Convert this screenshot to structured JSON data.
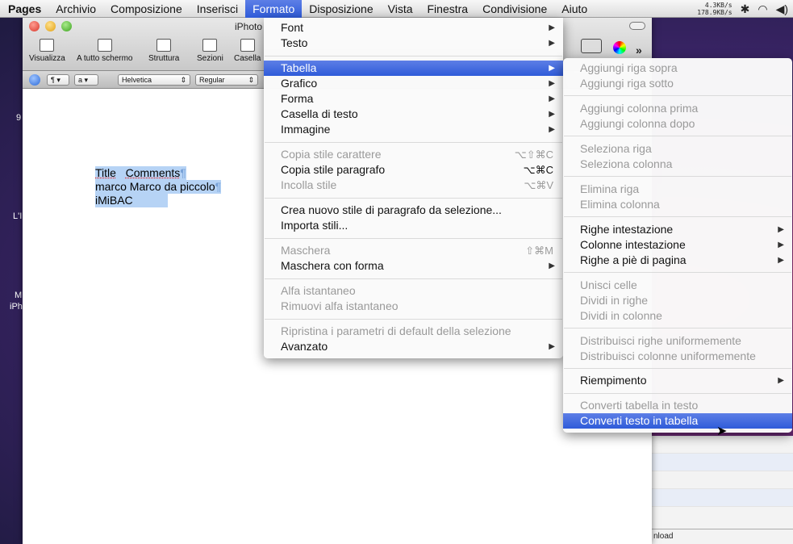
{
  "menubar": {
    "app": "Pages",
    "items": [
      "Archivio",
      "Composizione",
      "Inserisci",
      "Formato",
      "Disposizione",
      "Vista",
      "Finestra",
      "Condivisione",
      "Aiuto"
    ],
    "active": "Formato",
    "netspeed_up": "4.3KB/s",
    "netspeed_down": "178.9KB/s"
  },
  "desktop": {
    "left_labels": [
      "9",
      "L'I",
      "M",
      "iPh"
    ]
  },
  "window": {
    "title": "iPhoto",
    "toolbar": {
      "visualizza": "Visualizza",
      "schermo": "A tutto schermo",
      "struttura": "Struttura",
      "sezioni": "Sezioni",
      "casella": "Casella"
    },
    "formatbar": {
      "paragraph": "¶",
      "char": "a",
      "font": "Helvetica",
      "style": "Regular"
    },
    "document": {
      "line1_a": "Title",
      "line1_b": "Comments",
      "line2": "marco Marco da piccolo",
      "line3": "iMiBAC",
      "pilcrow": "¶"
    }
  },
  "background_window": {
    "download_label": "nload"
  },
  "formato_menu": {
    "items": [
      {
        "label": "Font",
        "submenu": true
      },
      {
        "label": "Testo",
        "submenu": true
      },
      {
        "label": "Tabella",
        "submenu": true,
        "highlighted": true
      },
      {
        "label": "Grafico",
        "submenu": true
      },
      {
        "label": "Forma",
        "submenu": true
      },
      {
        "label": "Casella di testo",
        "submenu": true
      },
      {
        "label": "Immagine",
        "submenu": true
      },
      {
        "label": "Copia stile carattere",
        "shortcut": "⌥⇧⌘C",
        "disabled": true
      },
      {
        "label": "Copia stile paragrafo",
        "shortcut": "⌥⌘C"
      },
      {
        "label": "Incolla stile",
        "shortcut": "⌥⌘V",
        "disabled": true
      },
      {
        "label": "Crea nuovo stile di paragrafo da selezione..."
      },
      {
        "label": "Importa stili..."
      },
      {
        "label": "Maschera",
        "shortcut": "⇧⌘M",
        "disabled": true
      },
      {
        "label": "Maschera con forma",
        "submenu": true
      },
      {
        "label": "Alfa istantaneo",
        "disabled": true
      },
      {
        "label": "Rimuovi alfa istantaneo",
        "disabled": true
      },
      {
        "label": "Ripristina i parametri di default della selezione",
        "disabled": true
      },
      {
        "label": "Avanzato",
        "submenu": true
      }
    ]
  },
  "tabella_submenu": {
    "items": [
      {
        "label": "Aggiungi riga sopra",
        "disabled": true
      },
      {
        "label": "Aggiungi riga sotto",
        "disabled": true
      },
      {
        "label": "Aggiungi colonna prima",
        "disabled": true
      },
      {
        "label": "Aggiungi colonna dopo",
        "disabled": true
      },
      {
        "label": "Seleziona riga",
        "disabled": true
      },
      {
        "label": "Seleziona colonna",
        "disabled": true
      },
      {
        "label": "Elimina riga",
        "disabled": true
      },
      {
        "label": "Elimina colonna",
        "disabled": true
      },
      {
        "label": "Righe intestazione",
        "submenu": true
      },
      {
        "label": "Colonne intestazione",
        "submenu": true
      },
      {
        "label": "Righe a piè di pagina",
        "submenu": true
      },
      {
        "label": "Unisci celle",
        "disabled": true
      },
      {
        "label": "Dividi in righe",
        "disabled": true
      },
      {
        "label": "Dividi in colonne",
        "disabled": true
      },
      {
        "label": "Distribuisci righe uniformemente",
        "disabled": true
      },
      {
        "label": "Distribuisci colonne uniformemente",
        "disabled": true
      },
      {
        "label": "Riempimento",
        "submenu": true
      },
      {
        "label": "Converti tabella in testo",
        "disabled": true
      },
      {
        "label": "Converti testo in tabella",
        "highlighted": true
      }
    ]
  }
}
